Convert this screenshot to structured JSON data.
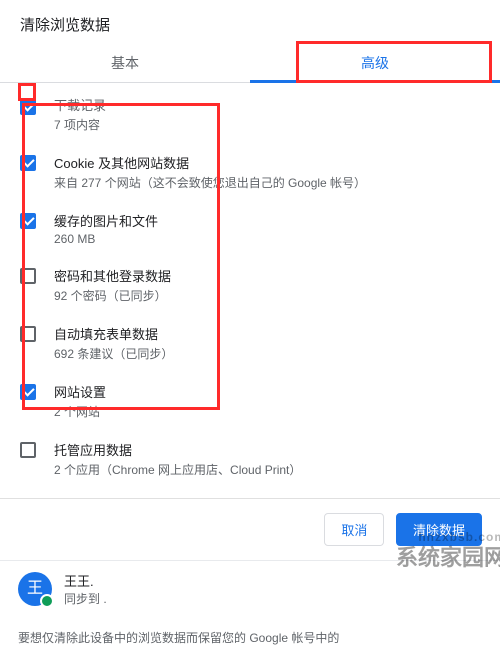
{
  "dialog": {
    "title": "清除浏览数据",
    "tabs": {
      "basic": "基本",
      "advanced": "高级",
      "active": "advanced"
    },
    "items": [
      {
        "checked": true,
        "title": "下载记录",
        "desc": "7 项内容",
        "truncated": true
      },
      {
        "checked": true,
        "title": "Cookie 及其他网站数据",
        "desc": "来自 277 个网站（这不会致使您退出自己的 Google 帐号）"
      },
      {
        "checked": true,
        "title": "缓存的图片和文件",
        "desc": "260 MB"
      },
      {
        "checked": false,
        "title": "密码和其他登录数据",
        "desc": "92 个密码（已同步）"
      },
      {
        "checked": false,
        "title": "自动填充表单数据",
        "desc": "692 条建议（已同步）"
      },
      {
        "checked": true,
        "title": "网站设置",
        "desc": "2 个网站"
      },
      {
        "checked": false,
        "title": "托管应用数据",
        "desc": "2 个应用（Chrome 网上应用店、Cloud Print）"
      }
    ],
    "actions": {
      "cancel": "取消",
      "confirm": "清除数据"
    },
    "account": {
      "avatar_initial": "王",
      "name": "王王.",
      "sub": "同步到 ."
    },
    "footnote": "要想仅清除此设备中的浏览数据而保留您的 Google 帐号中的"
  },
  "watermark": {
    "top": "hnzxbsb.com",
    "main": "系统家园网"
  }
}
